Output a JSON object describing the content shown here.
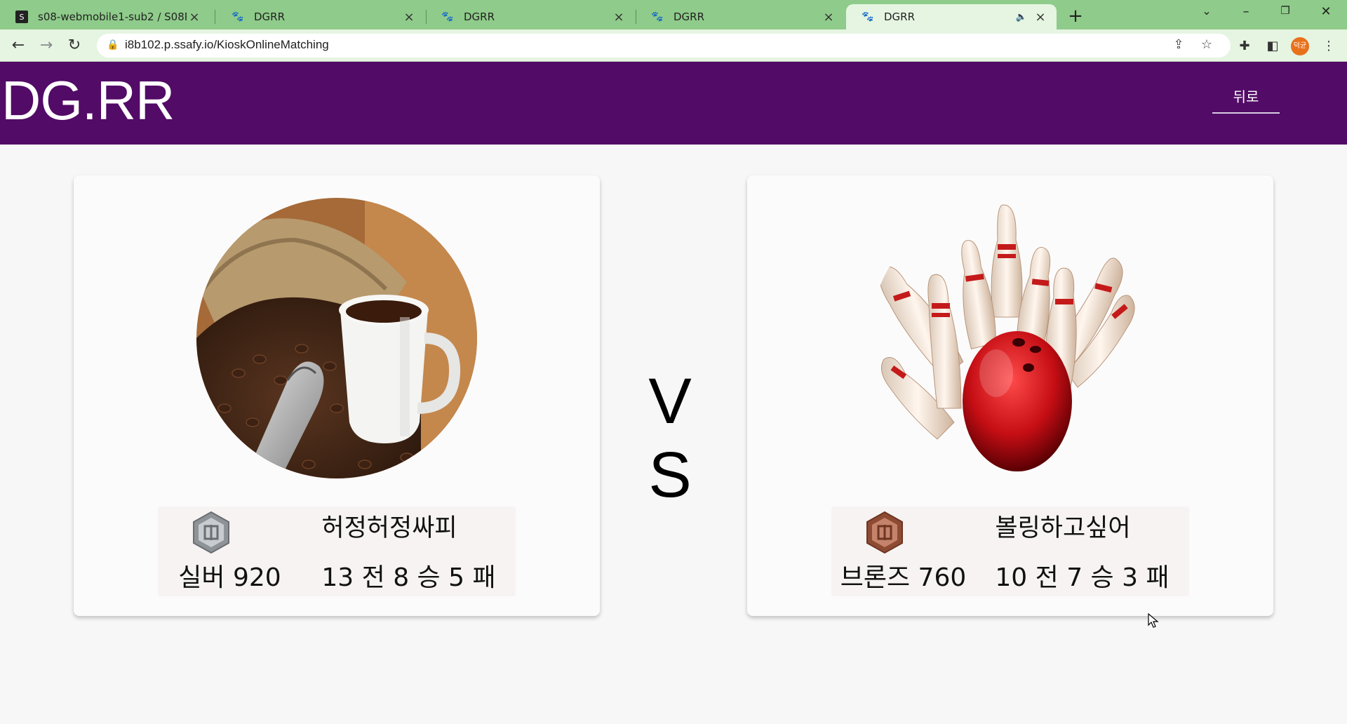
{
  "browser": {
    "tabs": [
      {
        "title": "s08-webmobile1-sub2 / S08P12",
        "active": false
      },
      {
        "title": "DGRR",
        "active": false
      },
      {
        "title": "DGRR",
        "active": false
      },
      {
        "title": "DGRR",
        "active": false
      },
      {
        "title": "DGRR",
        "active": true
      }
    ],
    "url": "i8b102.p.ssafy.io/KioskOnlineMatching",
    "profile_initial": "덕균"
  },
  "app": {
    "brand": "DG.RR",
    "back_label": "뒤로",
    "vs_label": "V S",
    "accent_color": "#520b66"
  },
  "players": [
    {
      "image": "coffee-beans-and-cup",
      "badge": "silver-tier-badge-icon",
      "badge_color": "#9a9ea2",
      "nickname": "허정허정싸피",
      "tier_label": "실버 920",
      "record": "13 전 8 승 5 패"
    },
    {
      "image": "bowling-ball-and-pins",
      "badge": "bronze-tier-badge-icon",
      "badge_color": "#a0614a",
      "nickname": "볼링하고싶어",
      "tier_label": "브론즈 760",
      "record": "10 전 7 승 3 패"
    }
  ]
}
